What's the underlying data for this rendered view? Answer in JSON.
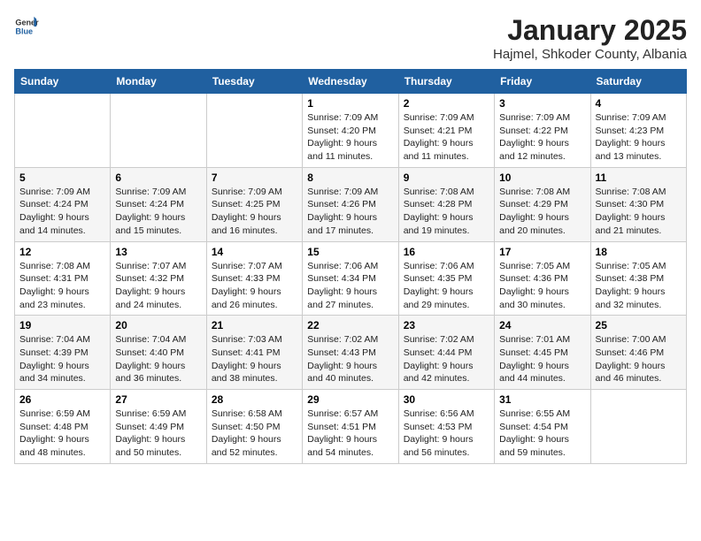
{
  "header": {
    "logo_general": "General",
    "logo_blue": "Blue",
    "title": "January 2025",
    "subtitle": "Hajmel, Shkoder County, Albania"
  },
  "weekdays": [
    "Sunday",
    "Monday",
    "Tuesday",
    "Wednesday",
    "Thursday",
    "Friday",
    "Saturday"
  ],
  "weeks": [
    [
      {
        "day": "",
        "content": ""
      },
      {
        "day": "",
        "content": ""
      },
      {
        "day": "",
        "content": ""
      },
      {
        "day": "1",
        "content": "Sunrise: 7:09 AM\nSunset: 4:20 PM\nDaylight: 9 hours\nand 11 minutes."
      },
      {
        "day": "2",
        "content": "Sunrise: 7:09 AM\nSunset: 4:21 PM\nDaylight: 9 hours\nand 11 minutes."
      },
      {
        "day": "3",
        "content": "Sunrise: 7:09 AM\nSunset: 4:22 PM\nDaylight: 9 hours\nand 12 minutes."
      },
      {
        "day": "4",
        "content": "Sunrise: 7:09 AM\nSunset: 4:23 PM\nDaylight: 9 hours\nand 13 minutes."
      }
    ],
    [
      {
        "day": "5",
        "content": "Sunrise: 7:09 AM\nSunset: 4:24 PM\nDaylight: 9 hours\nand 14 minutes."
      },
      {
        "day": "6",
        "content": "Sunrise: 7:09 AM\nSunset: 4:24 PM\nDaylight: 9 hours\nand 15 minutes."
      },
      {
        "day": "7",
        "content": "Sunrise: 7:09 AM\nSunset: 4:25 PM\nDaylight: 9 hours\nand 16 minutes."
      },
      {
        "day": "8",
        "content": "Sunrise: 7:09 AM\nSunset: 4:26 PM\nDaylight: 9 hours\nand 17 minutes."
      },
      {
        "day": "9",
        "content": "Sunrise: 7:08 AM\nSunset: 4:28 PM\nDaylight: 9 hours\nand 19 minutes."
      },
      {
        "day": "10",
        "content": "Sunrise: 7:08 AM\nSunset: 4:29 PM\nDaylight: 9 hours\nand 20 minutes."
      },
      {
        "day": "11",
        "content": "Sunrise: 7:08 AM\nSunset: 4:30 PM\nDaylight: 9 hours\nand 21 minutes."
      }
    ],
    [
      {
        "day": "12",
        "content": "Sunrise: 7:08 AM\nSunset: 4:31 PM\nDaylight: 9 hours\nand 23 minutes."
      },
      {
        "day": "13",
        "content": "Sunrise: 7:07 AM\nSunset: 4:32 PM\nDaylight: 9 hours\nand 24 minutes."
      },
      {
        "day": "14",
        "content": "Sunrise: 7:07 AM\nSunset: 4:33 PM\nDaylight: 9 hours\nand 26 minutes."
      },
      {
        "day": "15",
        "content": "Sunrise: 7:06 AM\nSunset: 4:34 PM\nDaylight: 9 hours\nand 27 minutes."
      },
      {
        "day": "16",
        "content": "Sunrise: 7:06 AM\nSunset: 4:35 PM\nDaylight: 9 hours\nand 29 minutes."
      },
      {
        "day": "17",
        "content": "Sunrise: 7:05 AM\nSunset: 4:36 PM\nDaylight: 9 hours\nand 30 minutes."
      },
      {
        "day": "18",
        "content": "Sunrise: 7:05 AM\nSunset: 4:38 PM\nDaylight: 9 hours\nand 32 minutes."
      }
    ],
    [
      {
        "day": "19",
        "content": "Sunrise: 7:04 AM\nSunset: 4:39 PM\nDaylight: 9 hours\nand 34 minutes."
      },
      {
        "day": "20",
        "content": "Sunrise: 7:04 AM\nSunset: 4:40 PM\nDaylight: 9 hours\nand 36 minutes."
      },
      {
        "day": "21",
        "content": "Sunrise: 7:03 AM\nSunset: 4:41 PM\nDaylight: 9 hours\nand 38 minutes."
      },
      {
        "day": "22",
        "content": "Sunrise: 7:02 AM\nSunset: 4:43 PM\nDaylight: 9 hours\nand 40 minutes."
      },
      {
        "day": "23",
        "content": "Sunrise: 7:02 AM\nSunset: 4:44 PM\nDaylight: 9 hours\nand 42 minutes."
      },
      {
        "day": "24",
        "content": "Sunrise: 7:01 AM\nSunset: 4:45 PM\nDaylight: 9 hours\nand 44 minutes."
      },
      {
        "day": "25",
        "content": "Sunrise: 7:00 AM\nSunset: 4:46 PM\nDaylight: 9 hours\nand 46 minutes."
      }
    ],
    [
      {
        "day": "26",
        "content": "Sunrise: 6:59 AM\nSunset: 4:48 PM\nDaylight: 9 hours\nand 48 minutes."
      },
      {
        "day": "27",
        "content": "Sunrise: 6:59 AM\nSunset: 4:49 PM\nDaylight: 9 hours\nand 50 minutes."
      },
      {
        "day": "28",
        "content": "Sunrise: 6:58 AM\nSunset: 4:50 PM\nDaylight: 9 hours\nand 52 minutes."
      },
      {
        "day": "29",
        "content": "Sunrise: 6:57 AM\nSunset: 4:51 PM\nDaylight: 9 hours\nand 54 minutes."
      },
      {
        "day": "30",
        "content": "Sunrise: 6:56 AM\nSunset: 4:53 PM\nDaylight: 9 hours\nand 56 minutes."
      },
      {
        "day": "31",
        "content": "Sunrise: 6:55 AM\nSunset: 4:54 PM\nDaylight: 9 hours\nand 59 minutes."
      },
      {
        "day": "",
        "content": ""
      }
    ]
  ]
}
